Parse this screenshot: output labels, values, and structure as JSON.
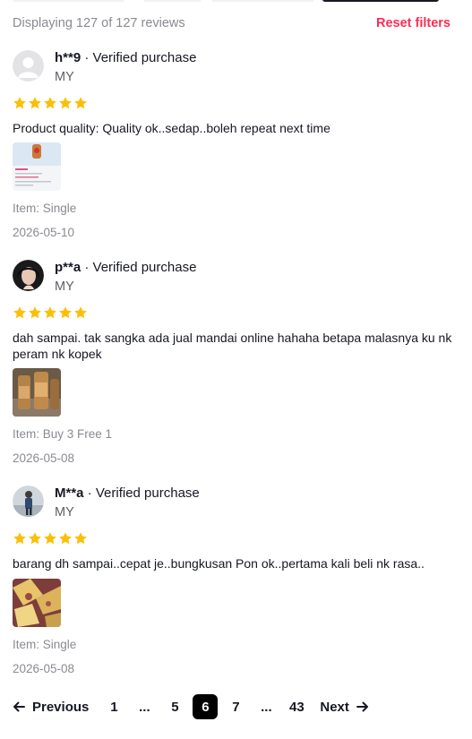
{
  "summary": {
    "displaying": "Displaying 127 of 127 reviews",
    "reset_label": "Reset filters"
  },
  "colors": {
    "accent": "#fe2c55",
    "star": "#fbbf07",
    "muted": "#8a8b91"
  },
  "reviews": [
    {
      "username": "h**9",
      "verified": " · Verified purchase",
      "region": "MY",
      "rating": 5,
      "text": "Product quality: Quality ok..sedap..boleh repeat next time",
      "item": "Item: Single",
      "date": "2026-05-10",
      "avatar_icon": "default-user-avatar"
    },
    {
      "username": "p**a",
      "verified": " · Verified purchase",
      "region": "MY",
      "rating": 5,
      "text": "dah sampai. tak sangka ada jual mandai online hahaha betapa malasnya ku nk peram nk kopek",
      "item": "Item: Buy 3 Free 1",
      "date": "2026-05-08",
      "avatar_icon": "user-photo-avatar"
    },
    {
      "username": "M**a",
      "verified": " · Verified purchase",
      "region": "MY",
      "rating": 5,
      "text": "barang dh sampai..cepat je..bungkusan Pon ok..pertama kali beli nk rasa..",
      "item": "Item: Single",
      "date": "2026-05-08",
      "avatar_icon": "user-photo-avatar"
    }
  ],
  "pagination": {
    "previous": "Previous",
    "next": "Next",
    "pages": [
      "1",
      "...",
      "5",
      "6",
      "7",
      "...",
      "43"
    ],
    "current": "6"
  }
}
